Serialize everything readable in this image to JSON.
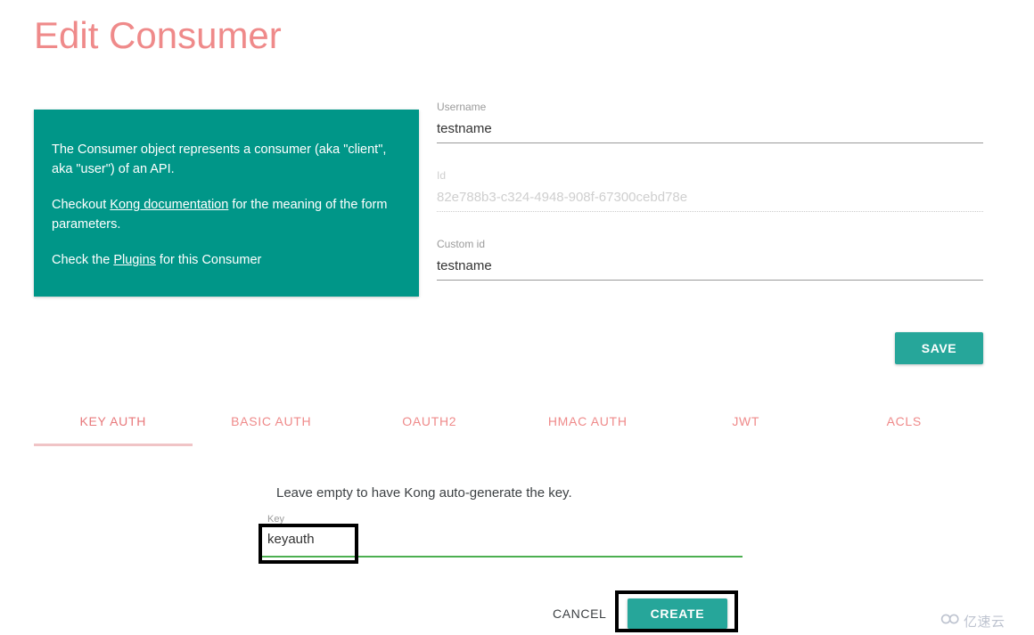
{
  "page": {
    "title": "Edit Consumer"
  },
  "info_card": {
    "paragraph1_before": "The Consumer object represents a consumer (aka \"client\", aka \"user\") of an API.",
    "paragraph2_before": "Checkout ",
    "paragraph2_link": "Kong documentation",
    "paragraph2_after": " for the meaning of the form parameters.",
    "paragraph3_before": "Check the ",
    "paragraph3_link": "Plugins",
    "paragraph3_after": " for this Consumer"
  },
  "form": {
    "username": {
      "label": "Username",
      "value": "testname"
    },
    "id": {
      "label": "Id",
      "value": "82e788b3-c324-4948-908f-67300cebd78e"
    },
    "custom_id": {
      "label": "Custom id",
      "value": "testname"
    },
    "save_label": "SAVE"
  },
  "tabs": [
    {
      "label": "KEY AUTH",
      "active": true
    },
    {
      "label": "BASIC AUTH",
      "active": false
    },
    {
      "label": "OAUTH2",
      "active": false
    },
    {
      "label": "HMAC AUTH",
      "active": false
    },
    {
      "label": "JWT",
      "active": false
    },
    {
      "label": "ACLS",
      "active": false
    }
  ],
  "key_auth_panel": {
    "hint": "Leave empty to have Kong auto-generate the key.",
    "key_label": "Key",
    "key_value": "keyauth",
    "cancel_label": "CANCEL",
    "create_label": "CREATE"
  },
  "watermark": {
    "text": "亿速云",
    "icon": "infinity-loop-logo"
  },
  "colors": {
    "title": "#ef8a8a",
    "teal_card": "#009688",
    "teal_button": "#26a69a",
    "tab_text": "#ef8a8a",
    "tab_underline": "#f0c4c6",
    "key_underline_green": "#4caf50",
    "annotation_box": "#000000"
  }
}
